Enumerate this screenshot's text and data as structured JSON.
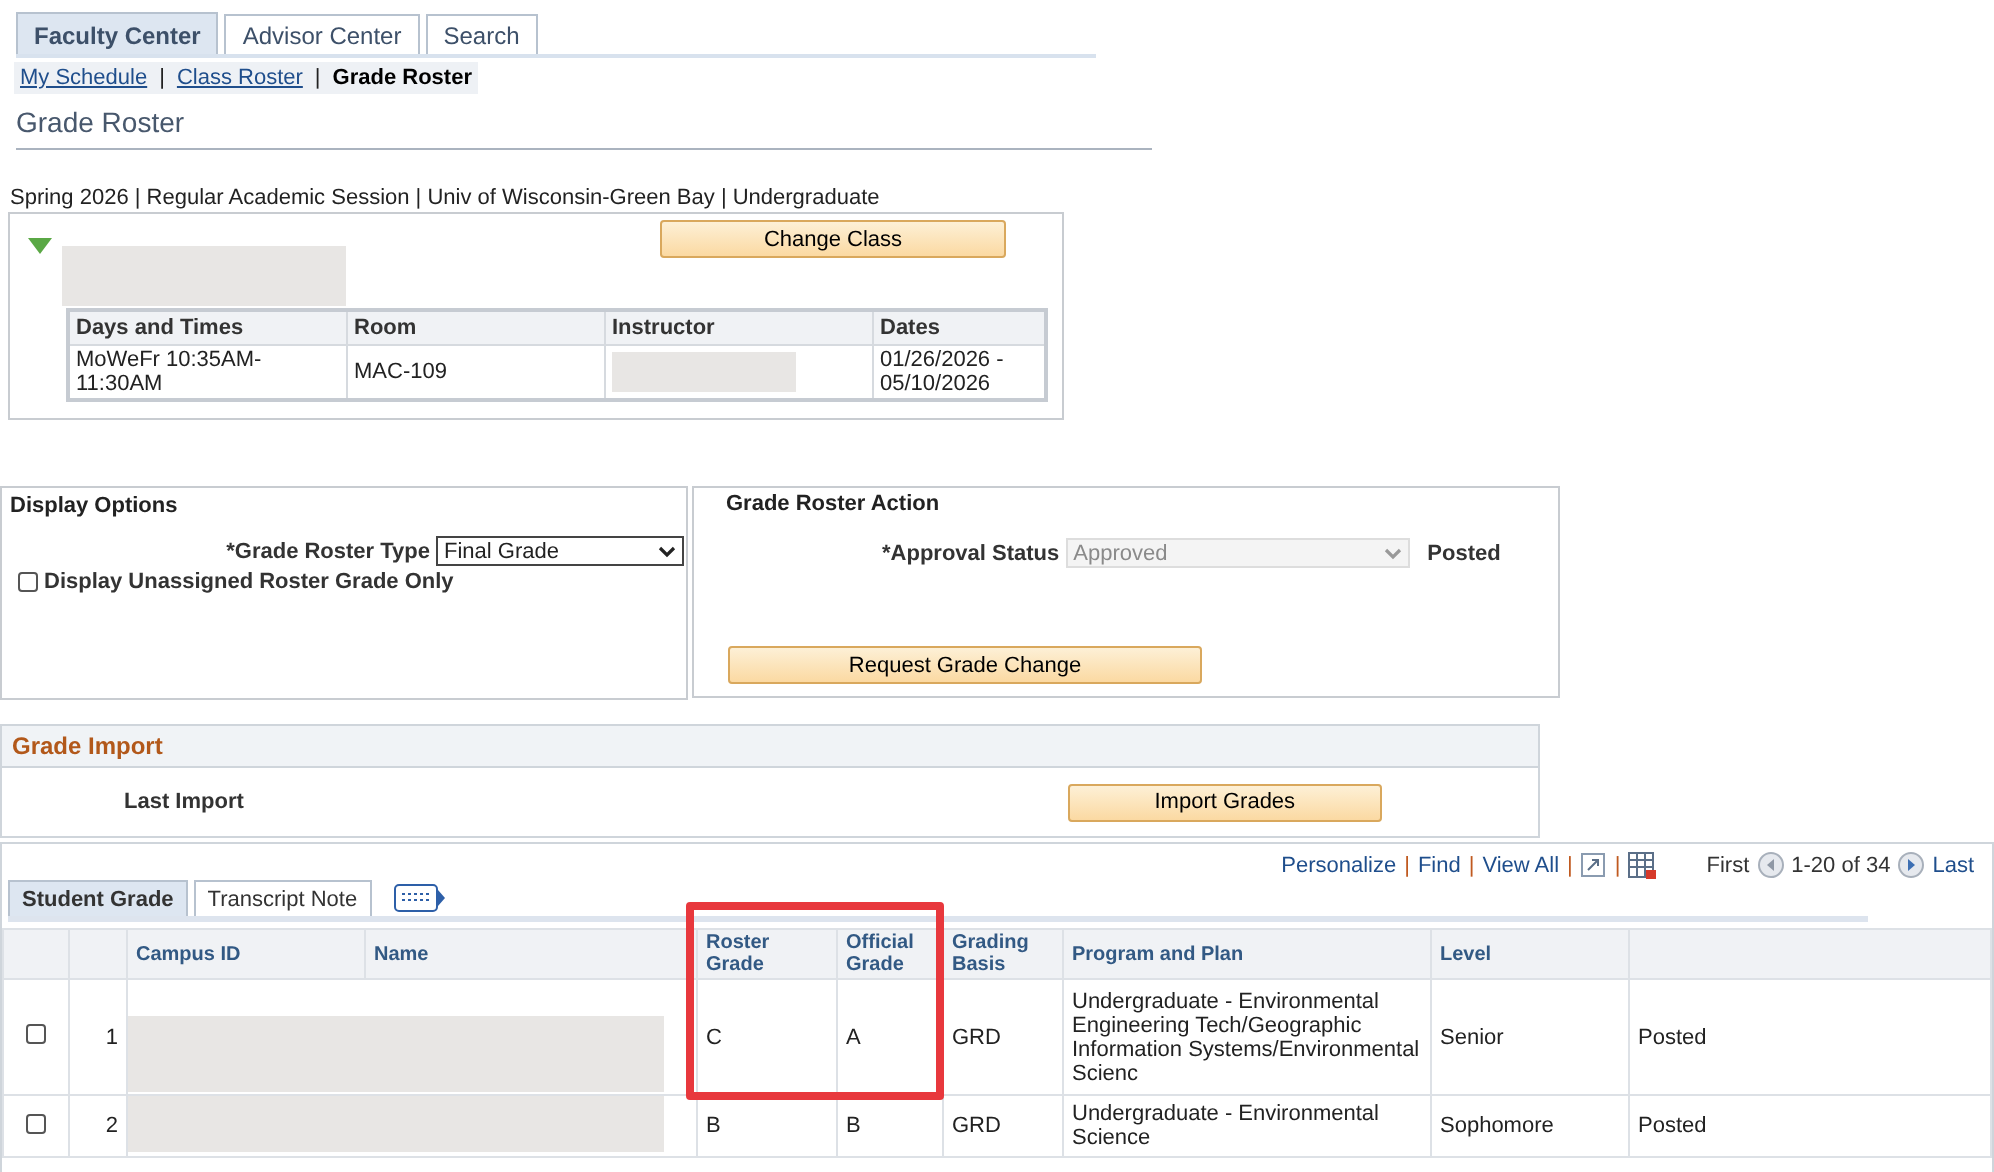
{
  "tabs": [
    {
      "label": "Faculty Center",
      "selected": true
    },
    {
      "label": "Advisor Center",
      "selected": false
    },
    {
      "label": "Search",
      "selected": false
    }
  ],
  "subnav": [
    {
      "label": "My Schedule",
      "selected": false
    },
    {
      "label": "Class Roster",
      "selected": false
    },
    {
      "label": "Grade Roster",
      "selected": true
    }
  ],
  "subnav_separator": "|",
  "page_title": "Grade Roster",
  "context": "Spring 2026 | Regular Academic Session | Univ of Wisconsin-Green Bay | Undergraduate",
  "class_section": {
    "expanded": true,
    "button": "Change Class",
    "meeting_table": {
      "columns": [
        "Days and Times",
        "Room",
        "Instructor",
        "Dates"
      ],
      "rows": [
        {
          "days_and_times": "MoWeFr 10:35AM-11:30AM",
          "room": "MAC-109",
          "dates": "01/26/2026 - 05/10/2026"
        }
      ]
    }
  },
  "display_options": {
    "title": "Display Options",
    "roster_type_label": "*Grade Roster Type",
    "roster_type_value": "Final Grade",
    "unassigned_label": "Display Unassigned Roster Grade Only",
    "unassigned_checked": false
  },
  "grade_roster_action": {
    "title": "Grade Roster Action",
    "approval_label": "*Approval Status",
    "approval_value": "Approved",
    "approval_disabled": true,
    "status": "Posted",
    "button": "Request Grade Change"
  },
  "grade_import": {
    "title": "Grade Import",
    "last_import_label": "Last Import",
    "button": "Import Grades"
  },
  "grid": {
    "links": [
      "Personalize",
      "Find",
      "View All"
    ],
    "separator": "|",
    "nav_first": "First",
    "range": "1-20 of 34",
    "nav_last": "Last",
    "tabs": [
      {
        "label": "Student Grade",
        "selected": true
      },
      {
        "label": "Transcript Note",
        "selected": false
      }
    ],
    "columns": [
      "",
      "",
      "Campus ID",
      "Name",
      "Roster Grade",
      "Official Grade",
      "Grading Basis",
      "Program and Plan",
      "Level",
      ""
    ],
    "rows": [
      {
        "checked": false,
        "number": "1",
        "roster_grade": "C",
        "official_grade": "A",
        "grading_basis": "GRD",
        "program": "Undergraduate - Environmental Engineering Tech/Geographic Information Systems/Environmental Scienc",
        "level": "Senior",
        "status": "Posted"
      },
      {
        "checked": false,
        "number": "2",
        "roster_grade": "B",
        "official_grade": "B",
        "grading_basis": "GRD",
        "program": "Undergraduate - Environmental Science",
        "level": "Sophomore",
        "status": "Posted"
      }
    ]
  }
}
